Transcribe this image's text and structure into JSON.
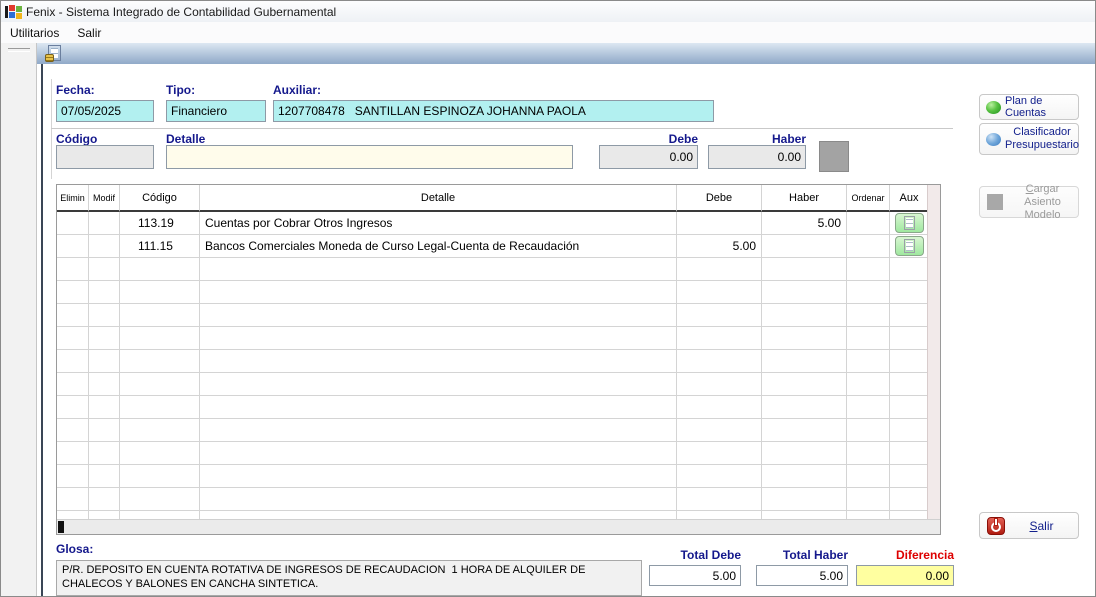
{
  "window": {
    "title": "Fenix - Sistema Integrado de Contabilidad Gubernamental"
  },
  "menu": {
    "items": [
      "Utilitarios",
      "Salir"
    ]
  },
  "form": {
    "fecha_label": "Fecha:",
    "fecha_value": "07/05/2025",
    "tipo_label": "Tipo:",
    "tipo_value": "Financiero",
    "auxiliar_label": "Auxiliar:",
    "auxiliar_value": "1207708478   SANTILLAN ESPINOZA JOHANNA PAOLA",
    "codigo_label": "Código",
    "codigo_value": "",
    "detalle_label": "Detalle",
    "detalle_value": "",
    "debe_label": "Debe",
    "debe_value": "0.00",
    "haber_label": "Haber",
    "haber_value": "0.00"
  },
  "table": {
    "headers": [
      "Elimin",
      "Modif",
      "Código",
      "Detalle",
      "Debe",
      "Haber",
      "Ordenar",
      "Aux"
    ],
    "rows": [
      {
        "codigo": "113.19",
        "detalle": "Cuentas por Cobrar Otros Ingresos",
        "debe": "",
        "haber": "5.00"
      },
      {
        "codigo": "111.15",
        "detalle": "Bancos Comerciales Moneda de Curso Legal-Cuenta de Recaudación",
        "debe": "5.00",
        "haber": ""
      }
    ],
    "empty_row_count": 12
  },
  "footer": {
    "glosa_label": "Glosa:",
    "glosa_value": "P/R. DEPOSITO EN CUENTA ROTATIVA DE INGRESOS DE RECAUDACION  1 HORA DE ALQUILER DE CHALECOS Y BALONES EN CANCHA SINTETICA.",
    "total_debe_label": "Total Debe",
    "total_debe_value": "5.00",
    "total_haber_label": "Total Haber",
    "total_haber_value": "5.00",
    "diferencia_label": "Diferencia",
    "diferencia_value": "0.00"
  },
  "side_buttons": {
    "plan": {
      "label": "Plan de Cuentas"
    },
    "clasificador": {
      "line1": "Clasificador",
      "line2": "Presupuestario"
    },
    "cargar": {
      "underline": "C",
      "line1_rest": "argar Asiento",
      "line2": "Modelo"
    },
    "salir": {
      "underline": "S",
      "rest": "alir"
    }
  },
  "colors": {
    "field_cyan": "#b2f0f0",
    "field_pale_yellow": "#fffceb",
    "diferencia_yellow": "#ffffa0",
    "label_navy": "#14188c",
    "diferencia_red": "#dd0000",
    "aux_button_green": "#9fe89f",
    "toolbar_blue": "#90a9c8"
  }
}
